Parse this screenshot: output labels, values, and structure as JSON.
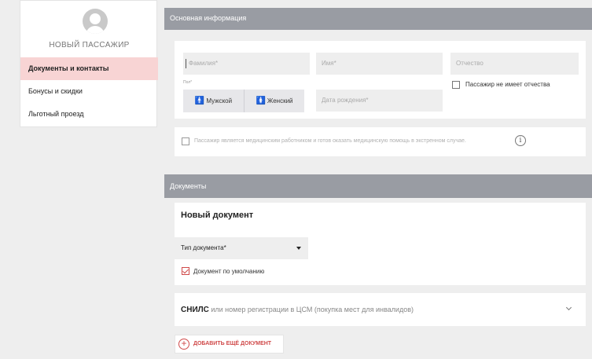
{
  "passenger": {
    "name": "НОВЫЙ ПАССАЖИР",
    "menu": [
      {
        "label": "Документы и контакты",
        "active": true
      },
      {
        "label": "Бонусы и скидки",
        "active": false
      },
      {
        "label": "Льготный проезд",
        "active": false
      }
    ]
  },
  "basic": {
    "header": "Основная информация",
    "last_name_placeholder": "Фамилия*",
    "first_name_placeholder": "Имя*",
    "middle_name_placeholder": "Отчество",
    "no_middle_name_label": "Пассажир не имеет отчества",
    "gender_label": "Пол*",
    "gender_male": "Мужской",
    "gender_female": "Женский",
    "birth_date_placeholder": "Дата рождения*",
    "medical_label": "Пассажир является медицинским работником и готов оказать медицинскую помощь в экстренном случае.",
    "info_icon": "i"
  },
  "documents": {
    "header": "Документы",
    "new_doc_title": "Новый документ",
    "doc_type_label": "Тип документа*",
    "default_doc_label": "Документ по умолчанию",
    "snils_bold": "СНИЛС",
    "snils_rest": " или номер регистрации в ЦСМ (покупка мест для инвалидов)",
    "add_doc_label": "ДОБАВИТЬ ЕЩЁ ДОКУМЕНТ",
    "add_icon": "+"
  },
  "colors": {
    "header_bg": "#999ca3",
    "active_menu_bg": "#f8d4d4",
    "accent_red": "#d04a4a",
    "male_icon": "#4aa3df",
    "female_icon": "#e06aa6"
  }
}
